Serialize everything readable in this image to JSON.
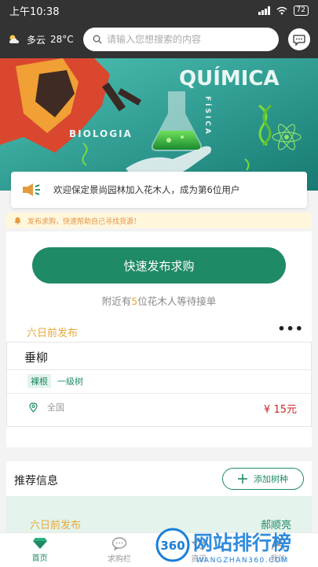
{
  "status_bar": {
    "time": "上午10:38",
    "battery": "72"
  },
  "header": {
    "weather": {
      "icon": "partly-cloudy-icon",
      "condition": "多云",
      "temperature": "28°C"
    },
    "search_placeholder": "请输入您想搜索的内容",
    "message_icon": "chat-bubble-icon"
  },
  "banner": {
    "words": [
      "QUÍMICA",
      "BIOLOGIA",
      "FÍSICA"
    ]
  },
  "notice": {
    "icon": "speaker-icon",
    "text": "欢迎保定景尚园林加入花木人，成为第6位用户"
  },
  "tip": {
    "icon": "bell-icon",
    "text": "发布求购，快速帮助自己寻找货源！"
  },
  "publish": {
    "button_label": "快速发布求购",
    "nearby_prefix": "附近有",
    "nearby_count": "5",
    "nearby_suffix": "位花木人等待接单"
  },
  "listing": {
    "time": "六日前发布",
    "more": "•••",
    "name": "垂柳",
    "tags": [
      "裸根",
      "一级树"
    ],
    "location": "全国",
    "price": "¥ 15元"
  },
  "recommend": {
    "title": "推荐信息",
    "add_button": "添加树种",
    "item": {
      "time": "六日前发布",
      "user": "郝顺亮"
    }
  },
  "bottom_nav": [
    {
      "label": "首页",
      "icon": "diamond-icon",
      "active": true
    },
    {
      "label": "求购栏",
      "icon": "chat-icon",
      "active": false
    },
    {
      "label": "资讯",
      "icon": "star-icon",
      "active": false
    },
    {
      "label": "我的",
      "icon": "user-icon",
      "active": false
    }
  ],
  "watermark": {
    "badge": "360",
    "title": "网站排行榜",
    "url": "WANGZHAN360.COM"
  },
  "colors": {
    "primary": "#1f8a66",
    "accent": "#e6a93b",
    "price": "#c62828",
    "header": "#333333"
  }
}
